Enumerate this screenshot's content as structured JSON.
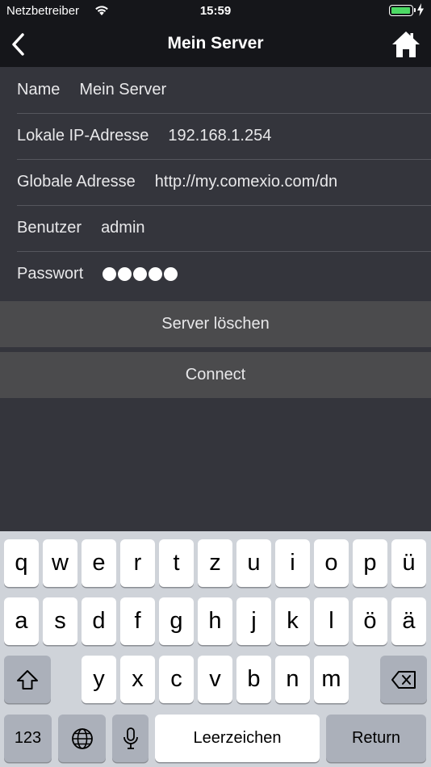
{
  "status": {
    "carrier": "Netzbetreiber",
    "time": "15:59",
    "battery_color": "#4cd964"
  },
  "nav": {
    "back_icon": "chevron-left-icon",
    "title": "Mein Server",
    "home_icon": "home-icon"
  },
  "form": {
    "name": {
      "label": "Name",
      "value": "Mein Server"
    },
    "local_ip": {
      "label": "Lokale IP-Adresse",
      "value": "192.168.1.254"
    },
    "global": {
      "label": "Globale Adresse",
      "value": "http://my.comexio.com/dn"
    },
    "user": {
      "label": "Benutzer",
      "value": "admin"
    },
    "password": {
      "label": "Passwort",
      "masked_length": 5
    }
  },
  "buttons": {
    "delete_server": "Server löschen",
    "connect": "Connect"
  },
  "keyboard": {
    "row1": [
      "q",
      "w",
      "e",
      "r",
      "t",
      "z",
      "u",
      "i",
      "o",
      "p",
      "ü"
    ],
    "row2": [
      "a",
      "s",
      "d",
      "f",
      "g",
      "h",
      "j",
      "k",
      "l",
      "ö",
      "ä"
    ],
    "row3": [
      "y",
      "x",
      "c",
      "v",
      "b",
      "n",
      "m"
    ],
    "numbers_key": "123",
    "space_key": "Leerzeichen",
    "return_key": "Return"
  }
}
